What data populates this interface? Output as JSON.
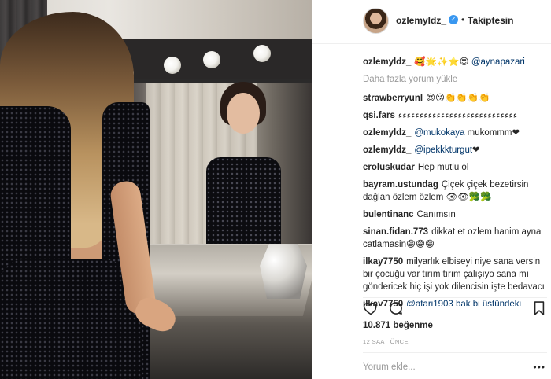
{
  "header": {
    "username": "ozlemyldz_",
    "verified_mark": "✓",
    "separator": "•",
    "follow_label": "Takiptesin"
  },
  "comments": {
    "caption": {
      "user": "ozlemyldz_",
      "text": "🥰🌟✨⭐😍 ",
      "mention": "@aynapazari"
    },
    "load_more": "Daha fazla yorum yükle",
    "items": [
      {
        "user": "strawberryunl",
        "text": "😍😘👏👏👏👏"
      },
      {
        "user": "qsi.fars",
        "text": "ءءءءءءءءءءءءءءءءءءءءءءءءءءءء"
      },
      {
        "user": "ozlemyldz_",
        "mention": "@mukokaya",
        "text": " mukommm❤"
      },
      {
        "user": "ozlemyldz_",
        "mention": "@ipekkkturgut",
        "text": "❤"
      },
      {
        "user": "eroluskudar",
        "text": "Hep mutlu ol"
      },
      {
        "user": "bayram.ustundag",
        "text": "Çiçek çiçek bezetirsin dağlan özlem özlem 👁👁🥦🥦"
      },
      {
        "user": "bulentinanc",
        "text": "Canımsın"
      },
      {
        "user": "sinan.fidan.773",
        "text": "dikkat et ozlem hanim ayna catlamasin😁😁😁"
      },
      {
        "user": "ilkay7750",
        "text": "milyarlık elbiseyi niye sana versin bir çocuğu var tırım tırım çalışıyo sana mı göndericek hiç işi yok dilencisin işte bedavacı"
      },
      {
        "user": "ilkay7750",
        "text": "@atari1903 bak bi üstündeki"
      }
    ]
  },
  "actions": {
    "like_icon": "heart-icon",
    "comment_icon": "comment-icon",
    "save_icon": "bookmark-icon"
  },
  "likes": "10.871 beğenme",
  "timestamp": "12 SAAT ÖNCE",
  "add_comment": {
    "placeholder": "Yorum ekle...",
    "more": "•••"
  }
}
